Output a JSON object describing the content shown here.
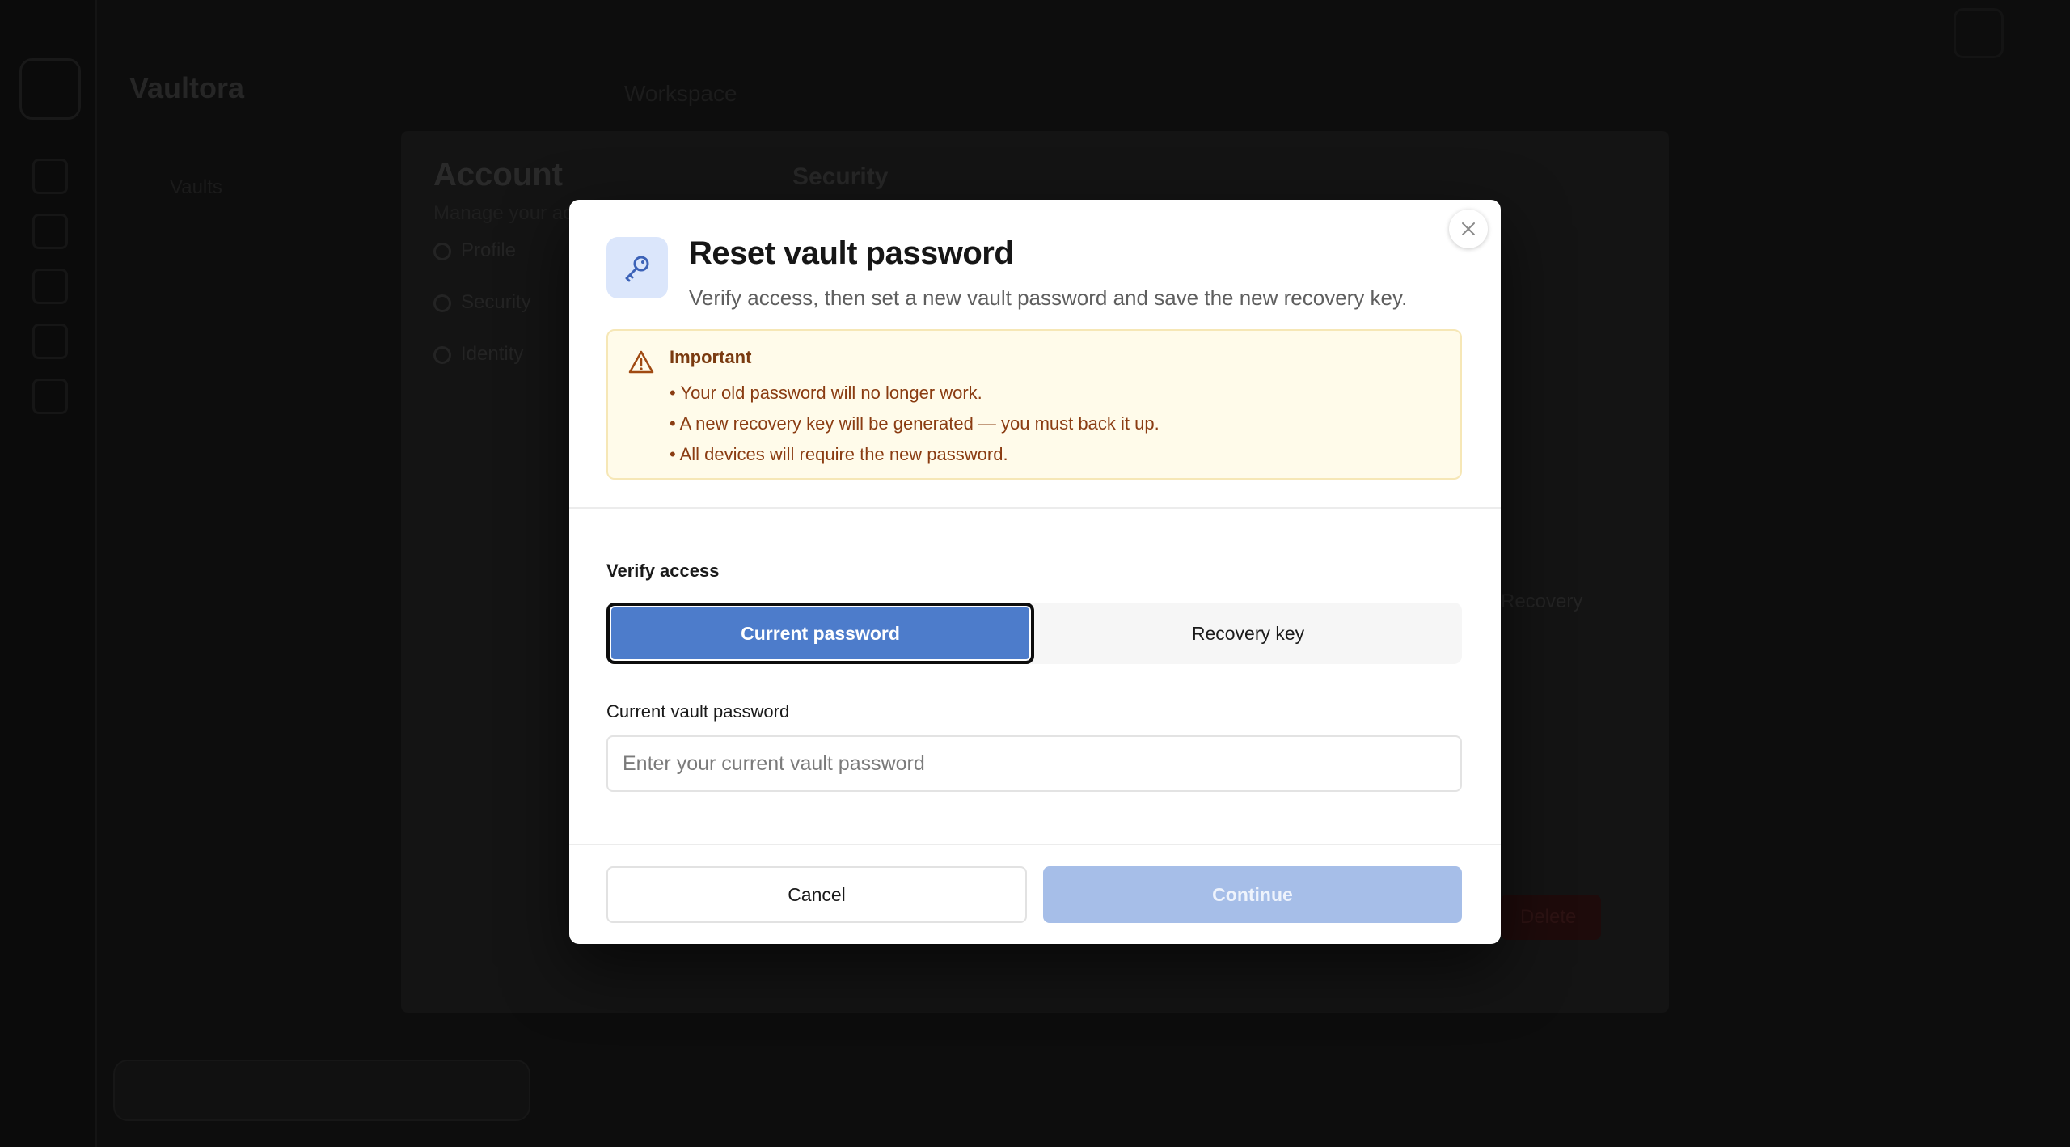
{
  "background": {
    "brand": "Vaultora",
    "search_hint": "Workspace",
    "nav_item": "Vaults",
    "settings": {
      "title": "Account",
      "subtitle": "Manage your account",
      "items": [
        "Profile",
        "Security",
        "Identity"
      ],
      "section_title": "Security",
      "side_text": "Recovery",
      "danger_button": "Delete"
    }
  },
  "modal": {
    "title": "Reset vault password",
    "description": "Verify access, then set a new vault password and save the new recovery key.",
    "icon": "key-icon",
    "warning": {
      "title": "Important",
      "icon": "warning-triangle-icon",
      "items": [
        "Your old password will no longer work.",
        "A new recovery key will be generated — you must back it up.",
        "All devices will require the new password."
      ]
    },
    "verify": {
      "label": "Verify access",
      "options": [
        "Current password",
        "Recovery key"
      ],
      "selected": "Current password"
    },
    "field": {
      "label": "Current vault password",
      "placeholder": "Enter your current vault password",
      "value": ""
    },
    "buttons": {
      "cancel": "Cancel",
      "continue": "Continue"
    }
  },
  "colors": {
    "accent": "#4d7ccb",
    "accent_disabled": "#a6bee8",
    "warning_bg": "#fffbea",
    "warning_text": "#8a3c12",
    "overlay": "#0a0a0a"
  }
}
